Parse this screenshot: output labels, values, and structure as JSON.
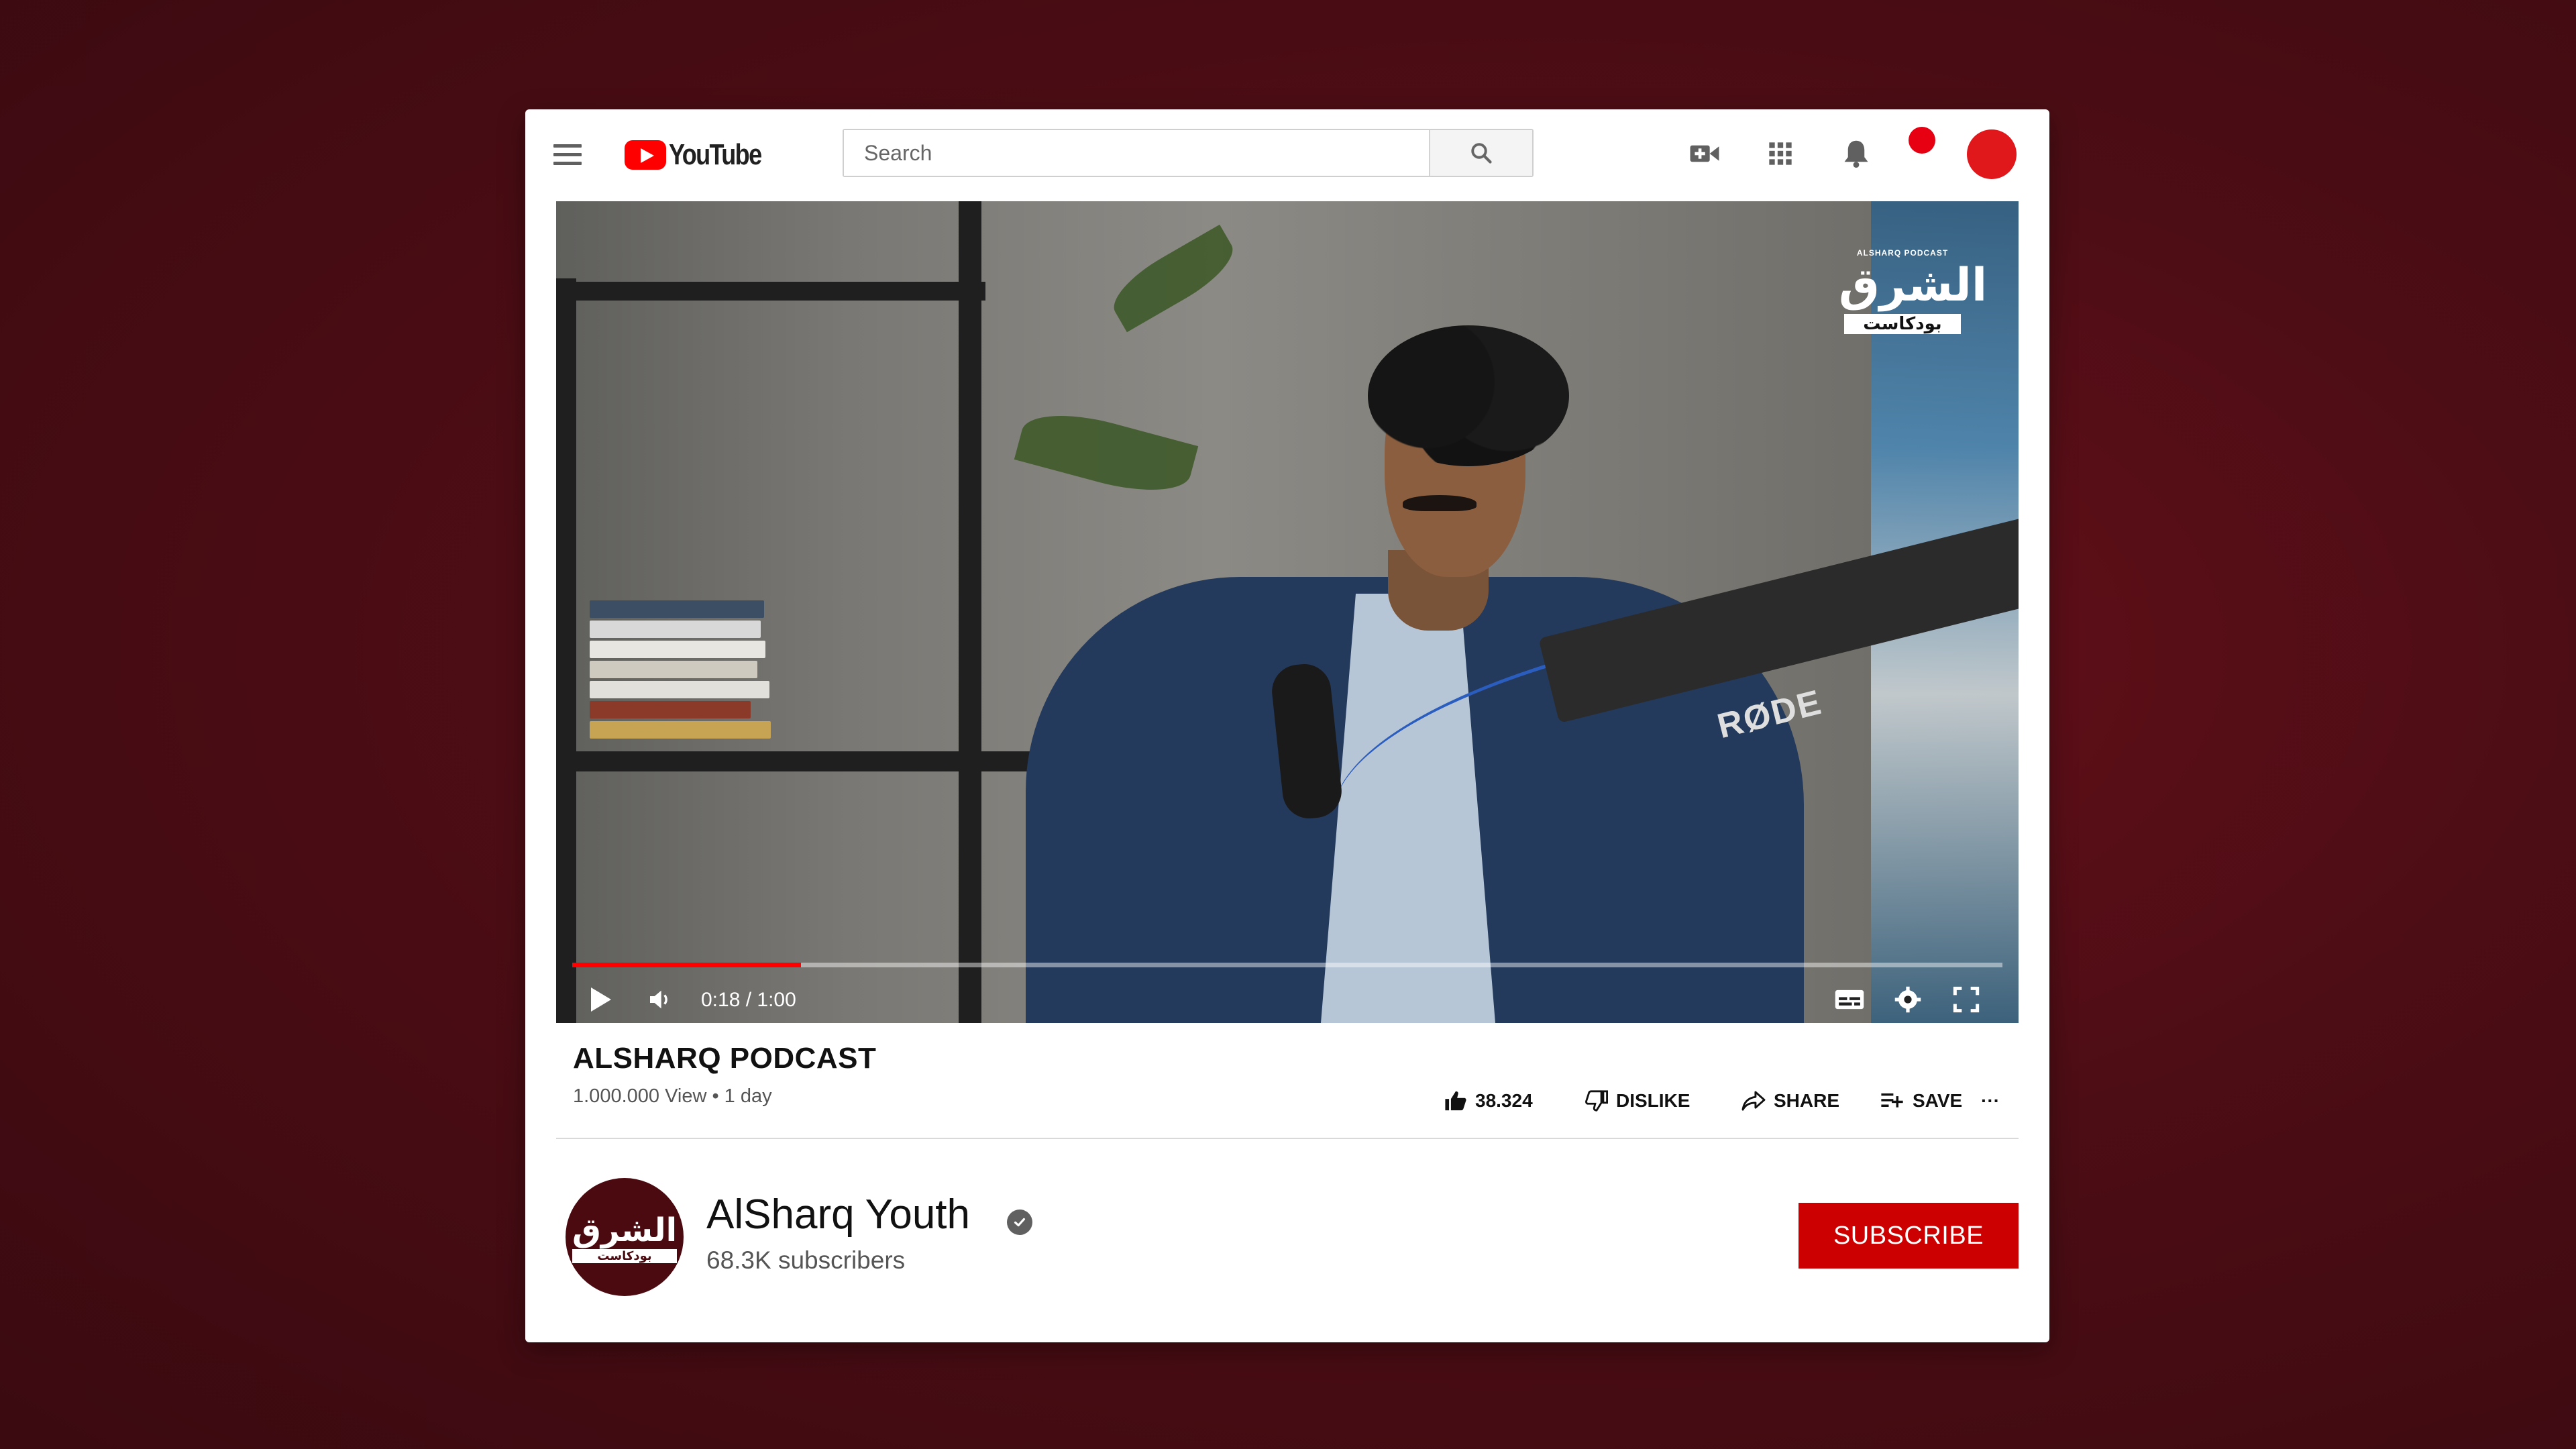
{
  "app": {
    "logo_text": "YouTube",
    "brand_color": "#ff0000"
  },
  "search": {
    "placeholder": "Search",
    "value": ""
  },
  "header_icons": [
    "menu-icon",
    "video-camera-plus-icon",
    "apps-grid-icon",
    "bell-icon",
    "account-avatar"
  ],
  "video": {
    "watermark_top": "ALSHARQ PODCAST",
    "watermark_main": "الشرق",
    "watermark_sub": "بودكاست",
    "mic_brand": "RØDE",
    "current_time": "0:18",
    "duration": "1:00",
    "time_display": "0:18 / 1:00",
    "progress_fraction": 0.16
  },
  "info": {
    "title": "ALSHARQ PODCAST",
    "meta": "1.000.000 View • 1 day"
  },
  "actions": {
    "like_count": "38.324",
    "dislike_label": "DISLIKE",
    "share_label": "SHARE",
    "save_label": "SAVE",
    "more_label": "···"
  },
  "channel": {
    "name": "AlSharq Youth",
    "subscribers": "68.3K subscribers",
    "verified": true,
    "subscribe_label": "SUBSCRIBE",
    "avatar_color": "#4b0a10"
  },
  "colors": {
    "subscribe": "#cc0000",
    "background": "#4e0d15",
    "notification": "#e60012"
  }
}
